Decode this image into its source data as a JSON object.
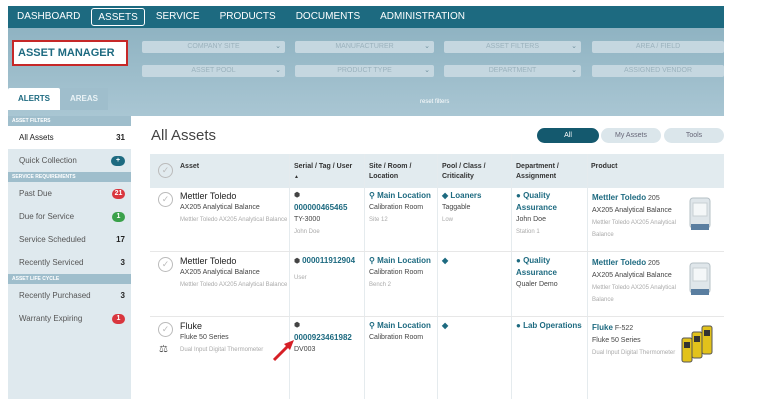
{
  "nav": [
    "DASHBOARD",
    "ASSETS",
    "SERVICE",
    "PRODUCTS",
    "DOCUMENTS",
    "ADMINISTRATION"
  ],
  "app_title": "ASSET MANAGER",
  "filters_row1": [
    "COMPANY SITE",
    "MANUFACTURER",
    "ASSET FILTERS",
    "AREA / FIELD"
  ],
  "filters_row2": [
    "ASSET POOL",
    "PRODUCT TYPE",
    "DEPARTMENT",
    "ASSIGNED VENDOR"
  ],
  "reset": "reset filters",
  "tabs": [
    "ALERTS",
    "AREAS"
  ],
  "sidebar": {
    "asset_filters_header": "ASSET FILTERS",
    "all_assets": "All Assets",
    "all_assets_count": "31",
    "quick_collection": "Quick Collection",
    "quick_collection_badge": "+",
    "service_header": "SERVICE REQUIREMENTS",
    "past_due": "Past Due",
    "past_due_count": "21",
    "due_for_service": "Due for Service",
    "due_for_service_count": "1",
    "service_scheduled": "Service Scheduled",
    "service_scheduled_count": "17",
    "recently_serviced": "Recently Serviced",
    "recently_serviced_count": "3",
    "lifecycle_header": "ASSET LIFE CYCLE",
    "recently_purchased": "Recently Purchased",
    "recently_purchased_count": "3",
    "warranty_expiring": "Warranty Expiring",
    "warranty_expiring_count": "1"
  },
  "main": {
    "title": "All Assets",
    "toggle_all": "All",
    "toggle_my": "My Assets",
    "toggle_tools": "Tools"
  },
  "columns": [
    "Asset",
    "Serial / Tag / User",
    "Site / Room / Location",
    "Pool / Class / Criticality",
    "Department / Assignment",
    "Product"
  ],
  "sort_indicator": "▲",
  "rows": [
    {
      "asset": "Mettler Toledo",
      "asset_sub": "AX205 Analytical Balance",
      "asset_muted": "Mettler Toledo AX205 Analytical Balance",
      "serial": "000000465465",
      "serial_sub": "TY-3000",
      "serial_muted": "John Doe",
      "site": "Main Location",
      "site_sub": "Calibration Room",
      "site_muted": "Site 12",
      "pool": "Loaners",
      "pool_sub": "Taggable",
      "pool_muted": "Low",
      "dept": "Quality Assurance",
      "dept_sub": "John Doe",
      "dept_muted": "Station 1",
      "product": "Mettler Toledo",
      "product_model": "205",
      "product_sub": "AX205 Analytical Balance",
      "product_muted": "Mettler Toledo AX205 Analytical Balance"
    },
    {
      "asset": "Mettler Toledo",
      "asset_sub": "AX205 Analytical Balance",
      "asset_muted": "Mettler Toledo AX205 Analytical Balance",
      "serial": "000011912904",
      "serial_sub": "",
      "serial_muted": "User",
      "site": "Main Location",
      "site_sub": "Calibration Room",
      "site_muted": "Bench 2",
      "pool": "",
      "pool_sub": "",
      "pool_muted": "",
      "dept": "Quality Assurance",
      "dept_sub": "Qualer Demo",
      "dept_muted": "",
      "product": "Mettler Toledo",
      "product_model": "205",
      "product_sub": "AX205 Analytical Balance",
      "product_muted": "Mettler Toledo AX205 Analytical Balance"
    },
    {
      "asset": "Fluke",
      "asset_sub": "Fluke 50 Series",
      "asset_muted": "Dual Input Digital Thermometer",
      "serial": "0000923461982",
      "serial_sub": "DV003",
      "serial_muted": "",
      "site": "Main Location",
      "site_sub": "Calibration Room",
      "site_muted": "",
      "pool": "",
      "pool_sub": "",
      "pool_muted": "",
      "dept": "Lab Operations",
      "dept_sub": "",
      "dept_muted": "",
      "product": "Fluke",
      "product_model": "F-522",
      "product_sub": "Fluke 50 Series",
      "product_muted": "Dual Input Digital Thermometer"
    }
  ],
  "colors": {
    "nav": "#1d6a80",
    "accent_red": "#d9363e",
    "accent_green": "#3aa14a",
    "link": "#1d6a80"
  }
}
